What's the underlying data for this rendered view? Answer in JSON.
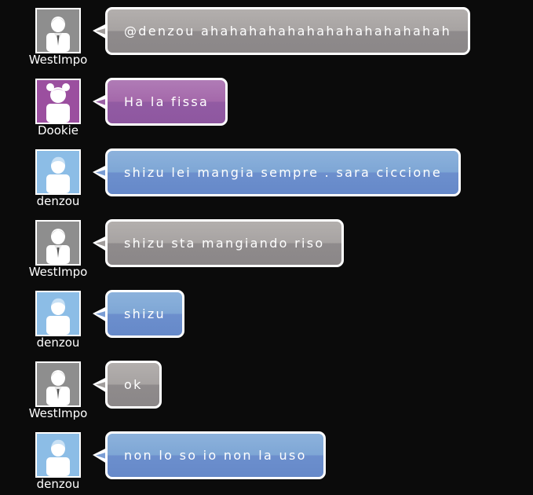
{
  "colors": {
    "gray": "#a19d9c",
    "purple": "#9b62a6",
    "blue": "#7a9dd4",
    "background": "#0b0b0b"
  },
  "messages": [
    {
      "user": "WestImpo",
      "avatar_icon": "businessman-avatar-icon",
      "theme": "gray",
      "text": "@denzou ahahahahahahahahahahahahah"
    },
    {
      "user": "Dookie",
      "avatar_icon": "girl-avatar-icon",
      "theme": "purple",
      "text": "Ha la fissa"
    },
    {
      "user": "denzou",
      "avatar_icon": "boy-avatar-icon",
      "theme": "blue",
      "text": "shizu lei mangia sempre . sara ciccione"
    },
    {
      "user": "WestImpo",
      "avatar_icon": "businessman-avatar-icon",
      "theme": "gray",
      "text": "shizu sta mangiando riso"
    },
    {
      "user": "denzou",
      "avatar_icon": "boy-avatar-icon",
      "theme": "blue",
      "text": "shizu"
    },
    {
      "user": "WestImpo",
      "avatar_icon": "businessman-avatar-icon",
      "theme": "gray",
      "text": "ok"
    },
    {
      "user": "denzou",
      "avatar_icon": "boy-avatar-icon",
      "theme": "blue",
      "text": "non lo so io non la uso"
    }
  ]
}
